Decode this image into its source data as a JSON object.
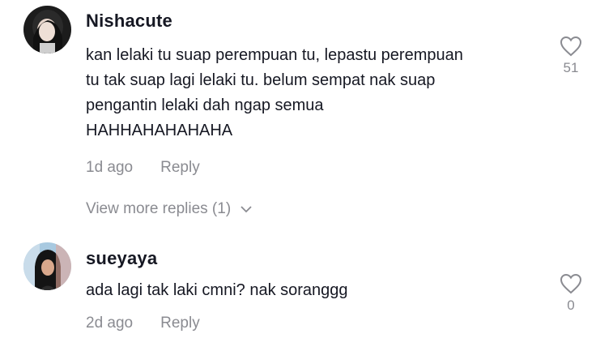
{
  "comments": [
    {
      "username": "Nishacute",
      "text": "kan lelaki tu suap perempuan tu, lepastu perempuan\ntu tak suap lagi lelaki tu. belum sempat nak suap\npengantin lelaki dah ngap semua\nHAHHAHAHAHAHA",
      "time": "1d ago",
      "reply_label": "Reply",
      "likes": "51"
    },
    {
      "username": "sueyaya",
      "text": "ada lagi tak laki cmni? nak soranggg",
      "time": "2d ago",
      "reply_label": "Reply",
      "likes": "0"
    }
  ],
  "view_more_replies": "View more replies (1)",
  "icons": {
    "like": "heart-outline-icon",
    "expand": "chevron-down-icon"
  },
  "colors": {
    "text": "#161823",
    "muted": "#8a8b91"
  }
}
